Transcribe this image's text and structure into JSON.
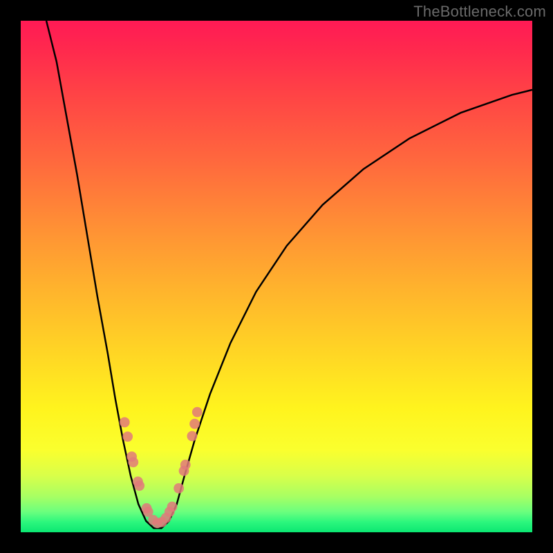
{
  "watermark": "TheBottleneck.com",
  "colors": {
    "curve_stroke": "#000000",
    "marker_fill": "#e07a7a",
    "marker_halo": "#e07a7a",
    "background_frame": "#000000"
  },
  "chart_data": {
    "type": "line",
    "title": "",
    "xlabel": "",
    "ylabel": "",
    "x_range": [
      0,
      100
    ],
    "y_range": [
      0,
      100
    ],
    "curve_points": [
      {
        "x": 5.0,
        "y": 100.0
      },
      {
        "x": 7.0,
        "y": 92.0
      },
      {
        "x": 9.0,
        "y": 81.0
      },
      {
        "x": 11.0,
        "y": 70.0
      },
      {
        "x": 13.0,
        "y": 58.0
      },
      {
        "x": 15.0,
        "y": 46.0
      },
      {
        "x": 17.0,
        "y": 35.0
      },
      {
        "x": 18.5,
        "y": 26.0
      },
      {
        "x": 20.0,
        "y": 18.0
      },
      {
        "x": 21.5,
        "y": 11.0
      },
      {
        "x": 23.0,
        "y": 5.5
      },
      {
        "x": 24.5,
        "y": 2.2
      },
      {
        "x": 26.0,
        "y": 0.8
      },
      {
        "x": 27.5,
        "y": 0.8
      },
      {
        "x": 29.0,
        "y": 2.2
      },
      {
        "x": 30.5,
        "y": 5.5
      },
      {
        "x": 32.0,
        "y": 11.0
      },
      {
        "x": 34.0,
        "y": 18.0
      },
      {
        "x": 37.0,
        "y": 27.0
      },
      {
        "x": 41.0,
        "y": 37.0
      },
      {
        "x": 46.0,
        "y": 47.0
      },
      {
        "x": 52.0,
        "y": 56.0
      },
      {
        "x": 59.0,
        "y": 64.0
      },
      {
        "x": 67.0,
        "y": 71.0
      },
      {
        "x": 76.0,
        "y": 77.0
      },
      {
        "x": 86.0,
        "y": 82.0
      },
      {
        "x": 96.0,
        "y": 85.5
      },
      {
        "x": 100.0,
        "y": 86.5
      }
    ],
    "markers": [
      {
        "x": 20.3,
        "y": 21.5
      },
      {
        "x": 20.9,
        "y": 18.7
      },
      {
        "x": 21.7,
        "y": 14.8
      },
      {
        "x": 22.0,
        "y": 13.7
      },
      {
        "x": 22.9,
        "y": 9.9
      },
      {
        "x": 23.2,
        "y": 9.1
      },
      {
        "x": 24.6,
        "y": 4.7
      },
      {
        "x": 24.9,
        "y": 4.0
      },
      {
        "x": 25.9,
        "y": 2.4
      },
      {
        "x": 26.7,
        "y": 1.8
      },
      {
        "x": 27.6,
        "y": 2.0
      },
      {
        "x": 28.4,
        "y": 2.8
      },
      {
        "x": 29.1,
        "y": 4.0
      },
      {
        "x": 29.6,
        "y": 5.0
      },
      {
        "x": 30.9,
        "y": 8.6
      },
      {
        "x": 31.9,
        "y": 12.0
      },
      {
        "x": 32.2,
        "y": 13.2
      },
      {
        "x": 33.5,
        "y": 18.8
      },
      {
        "x": 34.0,
        "y": 21.2
      },
      {
        "x": 34.5,
        "y": 23.5
      }
    ],
    "marker_radius_x_units": 1.0
  }
}
